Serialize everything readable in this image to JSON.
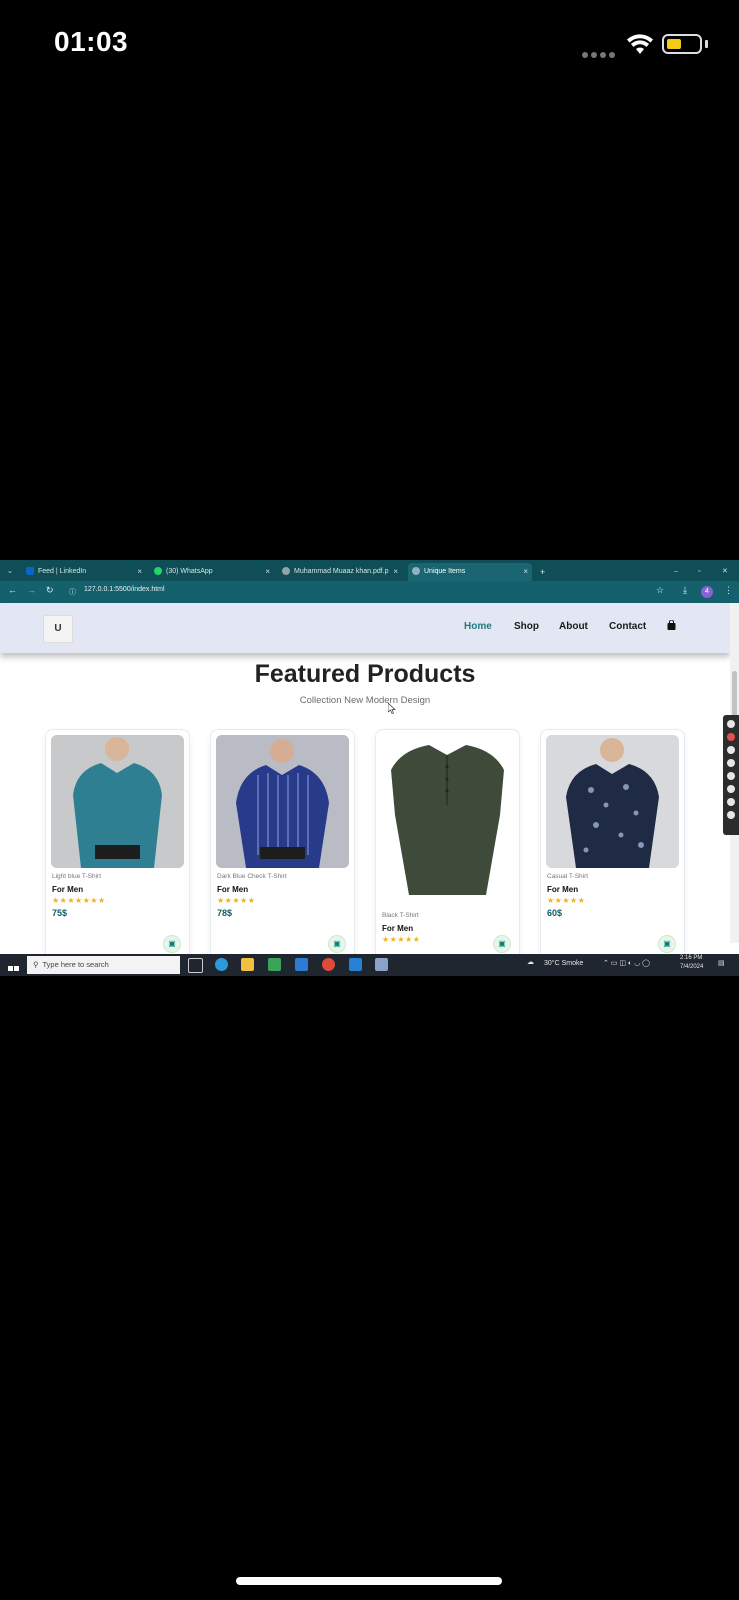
{
  "status_bar": {
    "time": "01:03"
  },
  "browser": {
    "tabs": [
      {
        "label": "Feed | LinkedIn",
        "close": "×"
      },
      {
        "label": "(30) WhatsApp",
        "close": "×"
      },
      {
        "label": "Muhammad Muaaz khan.pdf.p",
        "close": "×"
      },
      {
        "label": "Unique Items",
        "close": "×"
      }
    ],
    "new_tab": "+",
    "url": "127.0.0.1:5500/index.html",
    "profile_initial": "4"
  },
  "site": {
    "logo": "U",
    "nav": [
      {
        "label": "Home",
        "active": true
      },
      {
        "label": "Shop"
      },
      {
        "label": "About"
      },
      {
        "label": "Contact"
      }
    ],
    "bag_icon": "shopping-bag-icon",
    "featured": {
      "title": "Featured Products",
      "subtitle": "Collection New Modern Design"
    },
    "products": [
      {
        "brand": "Light blue T-Shirt",
        "name": "For Men",
        "stars": "★★★★★★★",
        "price": "75$",
        "shirt_color": "#2f7f93"
      },
      {
        "brand": "Dark Blue Check T-Shirt",
        "name": "For Men",
        "stars": "★★★★★",
        "price": "78$",
        "shirt_color": "#283a8a"
      },
      {
        "brand": "Black T-Shirt",
        "name": "For Men",
        "stars": "★★★★★",
        "price": "",
        "shirt_color": "#3e4a3a"
      },
      {
        "brand": "Casual T-Shirt",
        "name": "For Men",
        "stars": "★★★★★",
        "price": "60$",
        "shirt_color": "#1f2a44"
      }
    ]
  },
  "taskbar": {
    "search_placeholder": "Type here to search",
    "weather": "30°C  Smoke",
    "clock_time": "2:16 PM",
    "clock_date": "7/4/2024"
  }
}
